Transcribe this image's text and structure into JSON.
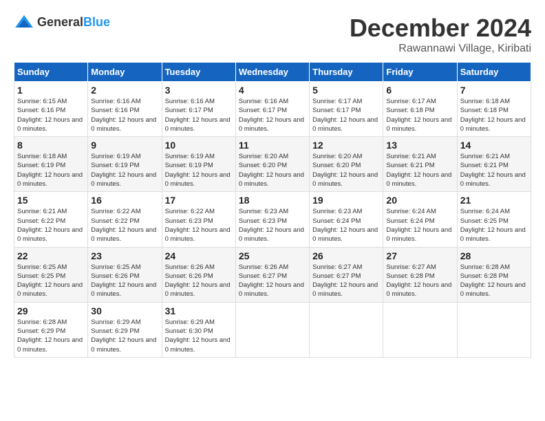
{
  "logo": {
    "text_general": "General",
    "text_blue": "Blue"
  },
  "title": "December 2024",
  "location": "Rawannawi Village, Kiribati",
  "days_of_week": [
    "Sunday",
    "Monday",
    "Tuesday",
    "Wednesday",
    "Thursday",
    "Friday",
    "Saturday"
  ],
  "weeks": [
    [
      {
        "day": "1",
        "sunrise": "6:15 AM",
        "sunset": "6:16 PM",
        "daylight": "12 hours and 0 minutes."
      },
      {
        "day": "2",
        "sunrise": "6:16 AM",
        "sunset": "6:16 PM",
        "daylight": "12 hours and 0 minutes."
      },
      {
        "day": "3",
        "sunrise": "6:16 AM",
        "sunset": "6:17 PM",
        "daylight": "12 hours and 0 minutes."
      },
      {
        "day": "4",
        "sunrise": "6:16 AM",
        "sunset": "6:17 PM",
        "daylight": "12 hours and 0 minutes."
      },
      {
        "day": "5",
        "sunrise": "6:17 AM",
        "sunset": "6:17 PM",
        "daylight": "12 hours and 0 minutes."
      },
      {
        "day": "6",
        "sunrise": "6:17 AM",
        "sunset": "6:18 PM",
        "daylight": "12 hours and 0 minutes."
      },
      {
        "day": "7",
        "sunrise": "6:18 AM",
        "sunset": "6:18 PM",
        "daylight": "12 hours and 0 minutes."
      }
    ],
    [
      {
        "day": "8",
        "sunrise": "6:18 AM",
        "sunset": "6:19 PM",
        "daylight": "12 hours and 0 minutes."
      },
      {
        "day": "9",
        "sunrise": "6:19 AM",
        "sunset": "6:19 PM",
        "daylight": "12 hours and 0 minutes."
      },
      {
        "day": "10",
        "sunrise": "6:19 AM",
        "sunset": "6:19 PM",
        "daylight": "12 hours and 0 minutes."
      },
      {
        "day": "11",
        "sunrise": "6:20 AM",
        "sunset": "6:20 PM",
        "daylight": "12 hours and 0 minutes."
      },
      {
        "day": "12",
        "sunrise": "6:20 AM",
        "sunset": "6:20 PM",
        "daylight": "12 hours and 0 minutes."
      },
      {
        "day": "13",
        "sunrise": "6:21 AM",
        "sunset": "6:21 PM",
        "daylight": "12 hours and 0 minutes."
      },
      {
        "day": "14",
        "sunrise": "6:21 AM",
        "sunset": "6:21 PM",
        "daylight": "12 hours and 0 minutes."
      }
    ],
    [
      {
        "day": "15",
        "sunrise": "6:21 AM",
        "sunset": "6:22 PM",
        "daylight": "12 hours and 0 minutes."
      },
      {
        "day": "16",
        "sunrise": "6:22 AM",
        "sunset": "6:22 PM",
        "daylight": "12 hours and 0 minutes."
      },
      {
        "day": "17",
        "sunrise": "6:22 AM",
        "sunset": "6:23 PM",
        "daylight": "12 hours and 0 minutes."
      },
      {
        "day": "18",
        "sunrise": "6:23 AM",
        "sunset": "6:23 PM",
        "daylight": "12 hours and 0 minutes."
      },
      {
        "day": "19",
        "sunrise": "6:23 AM",
        "sunset": "6:24 PM",
        "daylight": "12 hours and 0 minutes."
      },
      {
        "day": "20",
        "sunrise": "6:24 AM",
        "sunset": "6:24 PM",
        "daylight": "12 hours and 0 minutes."
      },
      {
        "day": "21",
        "sunrise": "6:24 AM",
        "sunset": "6:25 PM",
        "daylight": "12 hours and 0 minutes."
      }
    ],
    [
      {
        "day": "22",
        "sunrise": "6:25 AM",
        "sunset": "6:25 PM",
        "daylight": "12 hours and 0 minutes."
      },
      {
        "day": "23",
        "sunrise": "6:25 AM",
        "sunset": "6:26 PM",
        "daylight": "12 hours and 0 minutes."
      },
      {
        "day": "24",
        "sunrise": "6:26 AM",
        "sunset": "6:26 PM",
        "daylight": "12 hours and 0 minutes."
      },
      {
        "day": "25",
        "sunrise": "6:26 AM",
        "sunset": "6:27 PM",
        "daylight": "12 hours and 0 minutes."
      },
      {
        "day": "26",
        "sunrise": "6:27 AM",
        "sunset": "6:27 PM",
        "daylight": "12 hours and 0 minutes."
      },
      {
        "day": "27",
        "sunrise": "6:27 AM",
        "sunset": "6:28 PM",
        "daylight": "12 hours and 0 minutes."
      },
      {
        "day": "28",
        "sunrise": "6:28 AM",
        "sunset": "6:28 PM",
        "daylight": "12 hours and 0 minutes."
      }
    ],
    [
      {
        "day": "29",
        "sunrise": "6:28 AM",
        "sunset": "6:29 PM",
        "daylight": "12 hours and 0 minutes."
      },
      {
        "day": "30",
        "sunrise": "6:29 AM",
        "sunset": "6:29 PM",
        "daylight": "12 hours and 0 minutes."
      },
      {
        "day": "31",
        "sunrise": "6:29 AM",
        "sunset": "6:30 PM",
        "daylight": "12 hours and 0 minutes."
      },
      null,
      null,
      null,
      null
    ]
  ]
}
